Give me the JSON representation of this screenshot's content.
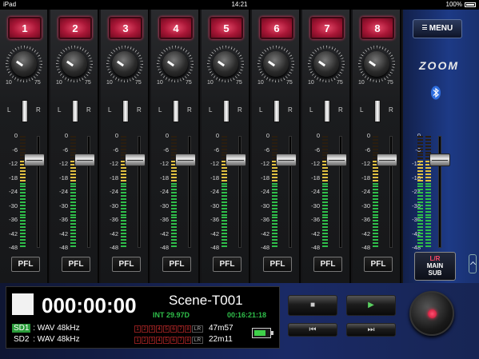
{
  "status_bar": {
    "device": "iPad",
    "time": "14:21",
    "battery": "100%"
  },
  "channels": [
    {
      "label": "1",
      "gain_low": "10",
      "gain_high": "75"
    },
    {
      "label": "2",
      "gain_low": "10",
      "gain_high": "75"
    },
    {
      "label": "3",
      "gain_low": "10",
      "gain_high": "75"
    },
    {
      "label": "4",
      "gain_low": "10",
      "gain_high": "75"
    },
    {
      "label": "5",
      "gain_low": "10",
      "gain_high": "75"
    },
    {
      "label": "6",
      "gain_low": "10",
      "gain_high": "75"
    },
    {
      "label": "7",
      "gain_low": "10",
      "gain_high": "75"
    },
    {
      "label": "8",
      "gain_low": "10",
      "gain_high": "75"
    }
  ],
  "pan": {
    "left": "L",
    "right": "R"
  },
  "meter_scale": [
    "0",
    "-6",
    "-12",
    "-18",
    "-24",
    "-30",
    "-36",
    "-42",
    "-48"
  ],
  "fader_level_db": -3,
  "pfl_label": "PFL",
  "right_panel": {
    "menu_label": "MENU",
    "brand": "ZOOM",
    "lr_button": {
      "line1": "L/R",
      "line2": "MAIN",
      "line3": "SUB"
    }
  },
  "display": {
    "timecode": "000:00:00",
    "scene": "Scene-T001",
    "tc_rate": "INT 29.97D",
    "tc_time": "00:16:21:18",
    "sd1": {
      "label": "SD1",
      "format": ": WAV 48kHz",
      "remain": "47m57"
    },
    "sd2": {
      "label": "SD2",
      "format": ": WAV 48kHz",
      "remain": "22m11"
    },
    "track_labels": [
      "1",
      "2",
      "3",
      "4",
      "5",
      "6",
      "7",
      "8",
      "LR"
    ],
    "battery_level": 0.7
  },
  "transport": {
    "stop": "■",
    "play": "▶",
    "rewind": "⏮",
    "forward": "⏭"
  },
  "colors": {
    "channel_button": "#c41e45",
    "meter_green": "#2fbf4a",
    "meter_yellow": "#e0c040",
    "panel_blue": "#1d3a86"
  }
}
